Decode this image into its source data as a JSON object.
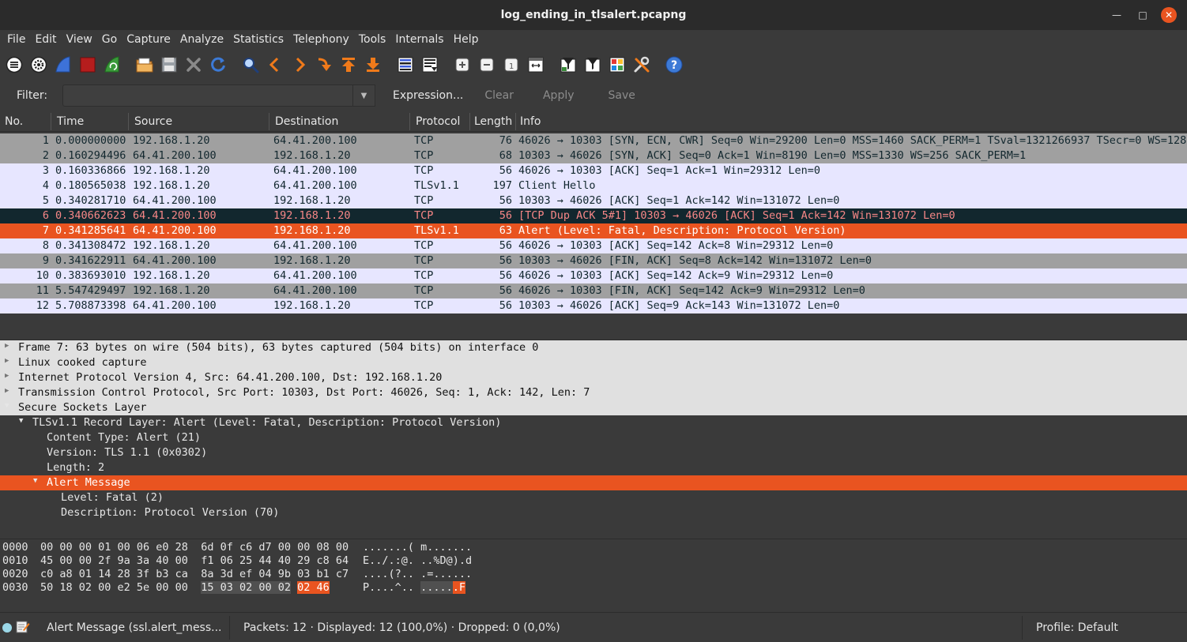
{
  "window": {
    "title": "log_ending_in_tlsalert.pcapng"
  },
  "menu": [
    "File",
    "Edit",
    "View",
    "Go",
    "Capture",
    "Analyze",
    "Statistics",
    "Telephony",
    "Tools",
    "Internals",
    "Help"
  ],
  "toolbar_icons": [
    "list-interfaces-icon",
    "capture-options-icon",
    "start-capture-icon",
    "stop-capture-icon",
    "restart-capture-icon",
    "open-file-icon",
    "save-file-icon",
    "close-file-icon",
    "reload-icon",
    "find-packet-icon",
    "go-back-icon",
    "go-forward-icon",
    "go-to-packet-icon",
    "go-first-icon",
    "go-last-icon",
    "colorize-icon",
    "autoscroll-icon",
    "zoom-in-icon",
    "zoom-out-icon",
    "normal-size-icon",
    "resize-columns-icon",
    "capture-filters-icon",
    "display-filters-icon",
    "coloring-rules-icon",
    "preferences-icon",
    "help-icon"
  ],
  "filter": {
    "label": "Filter:",
    "value": "",
    "expression": "Expression...",
    "clear": "Clear",
    "apply": "Apply",
    "save": "Save"
  },
  "packet_list": {
    "columns": [
      "No.",
      "Time",
      "Source",
      "Destination",
      "Protocol",
      "Length",
      "Info"
    ],
    "rows": [
      {
        "no": "1",
        "time": "0.000000000",
        "src": "192.168.1.20",
        "dst": "64.41.200.100",
        "proto": "TCP",
        "len": "76",
        "info": "46026 → 10303 [SYN, ECN, CWR] Seq=0 Win=29200 Len=0 MSS=1460 SACK_PERM=1 TSval=1321266937 TSecr=0 WS=128",
        "style": "grey"
      },
      {
        "no": "2",
        "time": "0.160294496",
        "src": "64.41.200.100",
        "dst": "192.168.1.20",
        "proto": "TCP",
        "len": "68",
        "info": "10303 → 46026 [SYN, ACK] Seq=0 Ack=1 Win=8190 Len=0 MSS=1330 WS=256 SACK_PERM=1",
        "style": "grey"
      },
      {
        "no": "3",
        "time": "0.160336866",
        "src": "192.168.1.20",
        "dst": "64.41.200.100",
        "proto": "TCP",
        "len": "56",
        "info": "46026 → 10303 [ACK] Seq=1 Ack=1 Win=29312 Len=0",
        "style": "tcp"
      },
      {
        "no": "4",
        "time": "0.180565038",
        "src": "192.168.1.20",
        "dst": "64.41.200.100",
        "proto": "TLSv1.1",
        "len": "197",
        "info": "Client Hello",
        "style": "tcp"
      },
      {
        "no": "5",
        "time": "0.340281710",
        "src": "64.41.200.100",
        "dst": "192.168.1.20",
        "proto": "TCP",
        "len": "56",
        "info": "10303 → 46026 [ACK] Seq=1 Ack=142 Win=131072 Len=0",
        "style": "tcp"
      },
      {
        "no": "6",
        "time": "0.340662623",
        "src": "64.41.200.100",
        "dst": "192.168.1.20",
        "proto": "TCP",
        "len": "56",
        "info": "[TCP Dup ACK 5#1] 10303 → 46026 [ACK] Seq=1 Ack=142 Win=131072 Len=0",
        "style": "bad"
      },
      {
        "no": "7",
        "time": "0.341285641",
        "src": "64.41.200.100",
        "dst": "192.168.1.20",
        "proto": "TLSv1.1",
        "len": "63",
        "info": "Alert (Level: Fatal, Description: Protocol Version)",
        "style": "sel"
      },
      {
        "no": "8",
        "time": "0.341308472",
        "src": "192.168.1.20",
        "dst": "64.41.200.100",
        "proto": "TCP",
        "len": "56",
        "info": "46026 → 10303 [ACK] Seq=142 Ack=8 Win=29312 Len=0",
        "style": "tcp"
      },
      {
        "no": "9",
        "time": "0.341622911",
        "src": "64.41.200.100",
        "dst": "192.168.1.20",
        "proto": "TCP",
        "len": "56",
        "info": "10303 → 46026 [FIN, ACK] Seq=8 Ack=142 Win=131072 Len=0",
        "style": "grey"
      },
      {
        "no": "10",
        "time": "0.383693010",
        "src": "192.168.1.20",
        "dst": "64.41.200.100",
        "proto": "TCP",
        "len": "56",
        "info": "46026 → 10303 [ACK] Seq=142 Ack=9 Win=29312 Len=0",
        "style": "tcp"
      },
      {
        "no": "11",
        "time": "5.547429497",
        "src": "192.168.1.20",
        "dst": "64.41.200.100",
        "proto": "TCP",
        "len": "56",
        "info": "46026 → 10303 [FIN, ACK] Seq=142 Ack=9 Win=29312 Len=0",
        "style": "grey"
      },
      {
        "no": "12",
        "time": "5.708873398",
        "src": "64.41.200.100",
        "dst": "192.168.1.20",
        "proto": "TCP",
        "len": "56",
        "info": "10303 → 46026 [ACK] Seq=9 Ack=143 Win=131072 Len=0",
        "style": "tcp"
      }
    ]
  },
  "details": [
    {
      "text": "Frame 7: 63 bytes on wire (504 bits), 63 bytes captured (504 bits) on interface 0",
      "level": 0,
      "state": "closed",
      "style": "hl"
    },
    {
      "text": "Linux cooked capture",
      "level": 0,
      "state": "closed",
      "style": "hl"
    },
    {
      "text": "Internet Protocol Version 4, Src: 64.41.200.100, Dst: 192.168.1.20",
      "level": 0,
      "state": "closed",
      "style": "hl"
    },
    {
      "text": "Transmission Control Protocol, Src Port: 10303, Dst Port: 46026, Seq: 1, Ack: 142, Len: 7",
      "level": 0,
      "state": "closed",
      "style": "hl"
    },
    {
      "text": "Secure Sockets Layer",
      "level": 0,
      "state": "open",
      "style": "hl"
    },
    {
      "text": "TLSv1.1 Record Layer: Alert (Level: Fatal, Description: Protocol Version)",
      "level": 1,
      "state": "open",
      "style": "plain"
    },
    {
      "text": "Content Type: Alert (21)",
      "level": 2,
      "state": "leaf",
      "style": "plain"
    },
    {
      "text": "Version: TLS 1.1 (0x0302)",
      "level": 2,
      "state": "leaf",
      "style": "plain"
    },
    {
      "text": "Length: 2",
      "level": 2,
      "state": "leaf",
      "style": "plain"
    },
    {
      "text": "Alert Message",
      "level": 2,
      "state": "open",
      "style": "sel"
    },
    {
      "text": "Level: Fatal (2)",
      "level": 3,
      "state": "leaf",
      "style": "plain"
    },
    {
      "text": "Description: Protocol Version (70)",
      "level": 3,
      "state": "leaf",
      "style": "plain"
    }
  ],
  "bytes": [
    {
      "offset": "0000",
      "hex": "00 00 00 01 00 06 e0 28  6d 0f c6 d7 00 00 08 00",
      "ascii": ".......( m......."
    },
    {
      "offset": "0010",
      "hex": "45 00 00 2f 9a 3a 40 00  f1 06 25 44 40 29 c8 64",
      "ascii": "E../.:@. ..%D@).d"
    },
    {
      "offset": "0020",
      "hex": "c0 a8 01 14 28 3f b3 ca  8a 3d ef 04 9b 03 b1 c7",
      "ascii": "....(?.. .=......"
    },
    {
      "offset": "0030",
      "hex_plain": "50 18 02 00 e2 5e 00 00  ",
      "hex_grey": "15 03 02 00 02",
      "hex_sel": "02 46",
      "ascii_plain": "P....^.. ",
      "ascii_grey": ".....",
      "ascii_sel": ".F"
    }
  ],
  "status": {
    "field": "Alert Message (ssl.alert_mess...",
    "packets": "Packets: 12 · Displayed: 12 (100,0%) · Dropped: 0 (0,0%)",
    "profile": "Profile: Default"
  }
}
